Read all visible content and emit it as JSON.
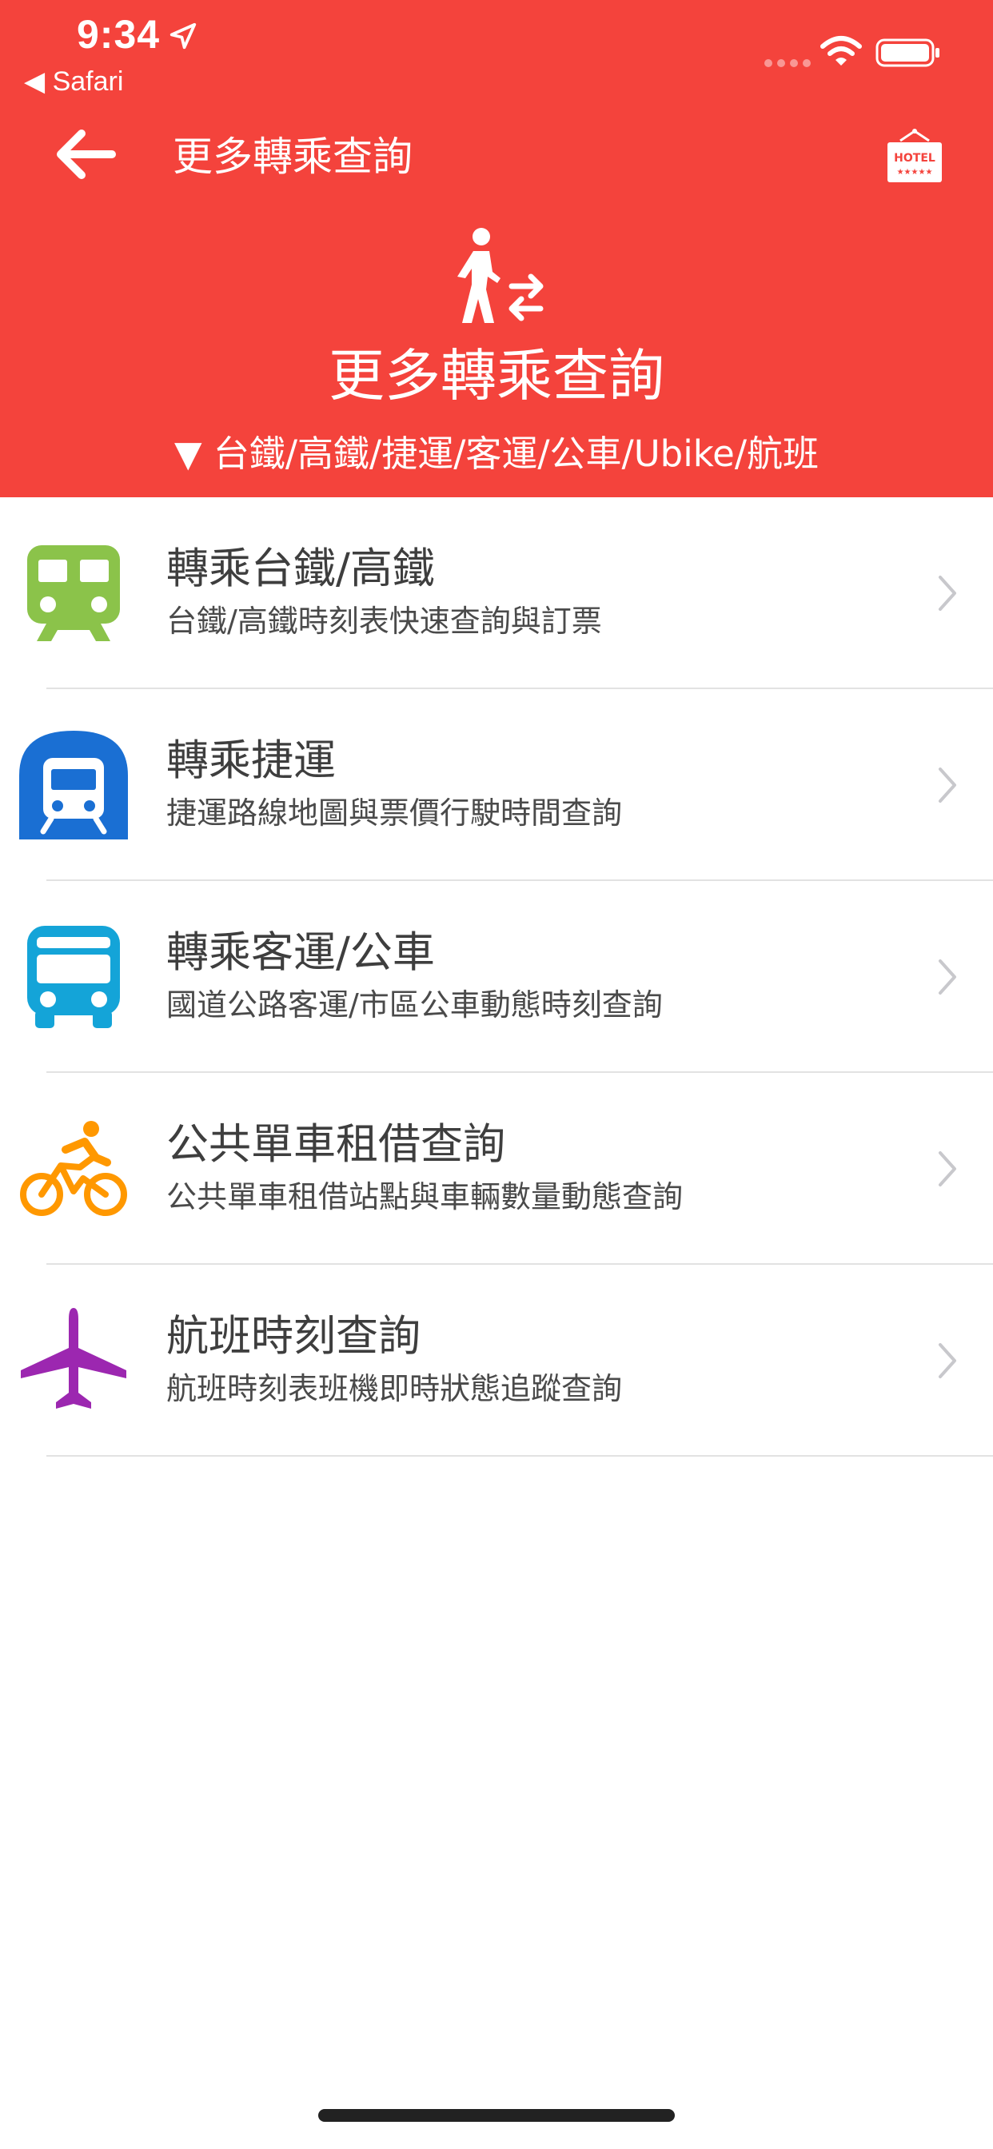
{
  "status_bar": {
    "time": "9:34",
    "back_app": "◀ Safari"
  },
  "nav": {
    "title": "更多轉乘查詢",
    "hotel_icon_text": "HOTEL"
  },
  "hero": {
    "title": "更多轉乘查詢",
    "subtitle": "▼ 台鐵/高鐵/捷運/客運/公車/Ubike/航班"
  },
  "items": [
    {
      "title": "轉乘台鐵/高鐵",
      "subtitle": "台鐵/高鐵時刻表快速查詢與訂票",
      "icon": "train-icon",
      "color": "#8bc34a"
    },
    {
      "title": "轉乘捷運",
      "subtitle": "捷運路線地圖與票價行駛時間查詢",
      "icon": "metro-icon",
      "color": "#1a6fd3"
    },
    {
      "title": "轉乘客運/公車",
      "subtitle": "國道公路客運/市區公車動態時刻查詢",
      "icon": "bus-icon",
      "color": "#14a4d8"
    },
    {
      "title": "公共單車租借查詢",
      "subtitle": "公共單車租借站點與車輛數量動態查詢",
      "icon": "bicycle-icon",
      "color": "#ff9800"
    },
    {
      "title": "航班時刻查詢",
      "subtitle": "航班時刻表班機即時狀態追蹤查詢",
      "icon": "airplane-icon",
      "color": "#9c27b0"
    }
  ],
  "colors": {
    "header": "#f4433c",
    "text": "#3e3e3e",
    "divider": "#e2e2e2"
  }
}
